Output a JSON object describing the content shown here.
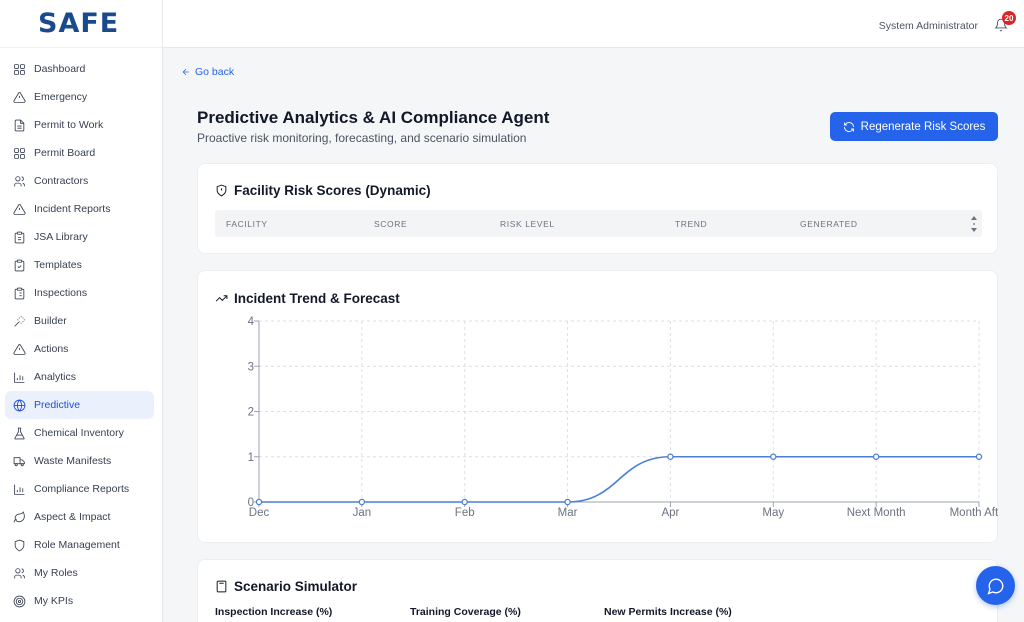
{
  "brand": {
    "logo_text": "SAFE",
    "color": "#1a4a8c"
  },
  "header": {
    "user_name": "System Administrator",
    "notification_count": "20"
  },
  "sidebar": {
    "items": [
      {
        "label": "Dashboard",
        "icon": "grid-icon"
      },
      {
        "label": "Emergency",
        "icon": "alert-triangle-icon"
      },
      {
        "label": "Permit to Work",
        "icon": "document-icon"
      },
      {
        "label": "Permit Board",
        "icon": "grid-icon"
      },
      {
        "label": "Contractors",
        "icon": "users-icon"
      },
      {
        "label": "Incident Reports",
        "icon": "alert-triangle-icon"
      },
      {
        "label": "JSA Library",
        "icon": "clipboard-icon"
      },
      {
        "label": "Templates",
        "icon": "clipboard-check-icon"
      },
      {
        "label": "Inspections",
        "icon": "clipboard-list-icon"
      },
      {
        "label": "Builder",
        "icon": "wand-icon"
      },
      {
        "label": "Actions",
        "icon": "alert-triangle-icon"
      },
      {
        "label": "Analytics",
        "icon": "bar-chart-icon"
      },
      {
        "label": "Predictive",
        "icon": "globe-icon",
        "active": true
      },
      {
        "label": "Chemical Inventory",
        "icon": "flask-icon"
      },
      {
        "label": "Waste Manifests",
        "icon": "truck-icon"
      },
      {
        "label": "Compliance Reports",
        "icon": "bar-chart-icon"
      },
      {
        "label": "Aspect & Impact",
        "icon": "leaf-icon"
      },
      {
        "label": "Role Management",
        "icon": "shield-icon"
      },
      {
        "label": "My Roles",
        "icon": "users-icon"
      },
      {
        "label": "My KPIs",
        "icon": "target-icon"
      }
    ]
  },
  "page": {
    "back_label": "Go back",
    "title": "Predictive Analytics & AI Compliance Agent",
    "subtitle": "Proactive risk monitoring, forecasting, and scenario simulation",
    "regenerate_label": "Regenerate Risk Scores"
  },
  "risk_scores": {
    "title": "Facility Risk Scores (Dynamic)",
    "columns": [
      "FACILITY",
      "SCORE",
      "RISK LEVEL",
      "TREND",
      "GENERATED"
    ]
  },
  "incident_trend": {
    "title": "Incident Trend & Forecast"
  },
  "chart_data": {
    "type": "line",
    "categories": [
      "Dec",
      "Jan",
      "Feb",
      "Mar",
      "Apr",
      "May",
      "Next Month",
      "Month After"
    ],
    "series": [
      {
        "values": [
          0,
          0,
          0,
          0,
          1,
          1,
          1,
          1
        ]
      }
    ],
    "ylim": [
      0,
      4
    ],
    "yticks": [
      0,
      1,
      2,
      3,
      4
    ],
    "grid": true,
    "line_color": "#4a7fd4",
    "title": "",
    "xlabel": "",
    "ylabel": ""
  },
  "simulator": {
    "title": "Scenario Simulator",
    "fields": [
      "Inspection Increase (%)",
      "Training Coverage (%)",
      "New Permits Increase (%)"
    ]
  },
  "colors": {
    "primary": "#2563eb",
    "active_bg": "#eaf1fd",
    "badge": "#dc2626"
  }
}
